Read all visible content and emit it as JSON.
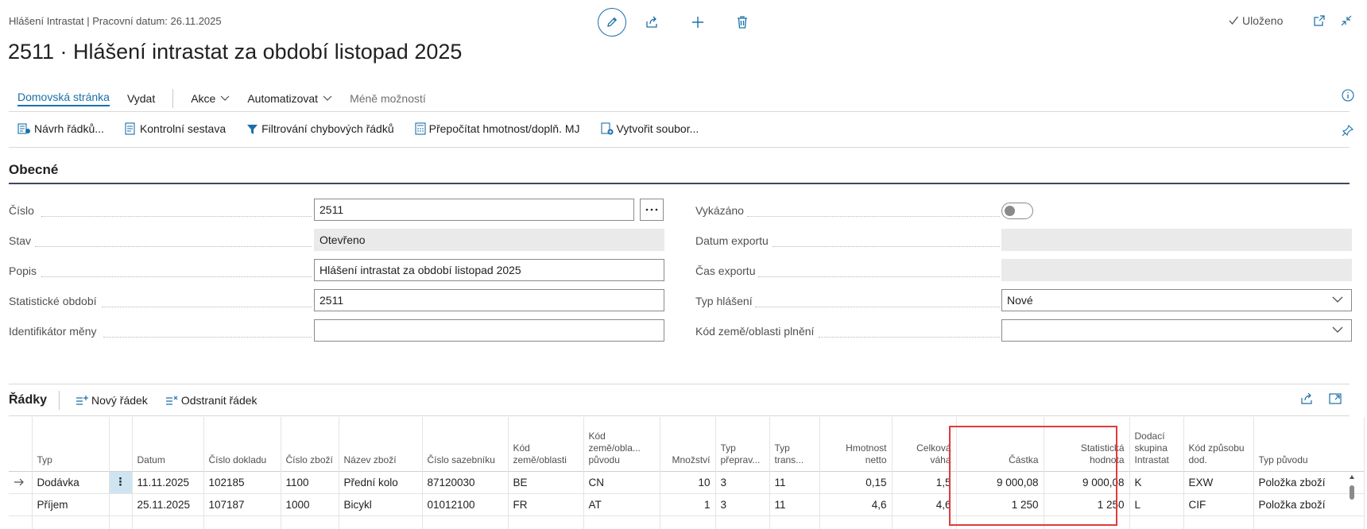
{
  "breadcrumb": "Hlášení Intrastat | Pracovní datum: 26.11.2025",
  "page_title": "2511 · Hlášení intrastat za období listopad 2025",
  "status": {
    "saved_label": "Uloženo"
  },
  "menu": {
    "home": "Domovská stránka",
    "publish": "Vydat",
    "actions": "Akce",
    "automate": "Automatizovat",
    "fewer": "Méně možností"
  },
  "actions": {
    "suggest_lines": "Návrh řádků...",
    "checklist": "Kontrolní sestava",
    "filter_errors": "Filtrování chybových řádků",
    "recalc": "Přepočítat hmotnost/doplň. MJ",
    "create_file": "Vytvořit soubor..."
  },
  "general": {
    "title": "Obecné",
    "fields_left": [
      {
        "label": "Číslo",
        "value": "2511"
      },
      {
        "label": "Stav",
        "value": "Otevřeno"
      },
      {
        "label": "Popis",
        "value": "Hlášení intrastat za období listopad 2025"
      },
      {
        "label": "Statistické období",
        "value": "2511"
      },
      {
        "label": "Identifikátor měny",
        "value": ""
      }
    ],
    "fields_right": [
      {
        "label": "Vykázáno",
        "value": ""
      },
      {
        "label": "Datum exportu",
        "value": ""
      },
      {
        "label": "Čas exportu",
        "value": ""
      },
      {
        "label": "Typ hlášení",
        "value": "Nové"
      },
      {
        "label": "Kód země/oblasti plnění",
        "value": ""
      }
    ],
    "reported_toggle": false
  },
  "lines": {
    "title": "Řádky",
    "new_line": "Nový řádek",
    "delete_line": "Odstranit řádek",
    "columns": [
      "Typ",
      "Datum",
      "Číslo dokladu",
      "Číslo zboží",
      "Název zboží",
      "Číslo sazebníku",
      "Kód země/oblasti",
      "Kód země/obla... původu",
      "Množství",
      "Typ přeprav...",
      "Typ trans...",
      "Hmotnost netto",
      "Celková váha",
      "Částka",
      "Statistická hodnota",
      "Dodací skupina Intrastat",
      "Kód způsobu dod.",
      "Typ původu"
    ],
    "rows": [
      [
        "Dodávka",
        "11.11.2025",
        "102185",
        "1100",
        "Přední kolo",
        "87120030",
        "BE",
        "CN",
        "10",
        "3",
        "11",
        "0,15",
        "1,5",
        "9 000,08",
        "9 000,08",
        "K",
        "EXW",
        "Položka zboží"
      ],
      [
        "Příjem",
        "25.11.2025",
        "107187",
        "1000",
        "Bicykl",
        "01012100",
        "FR",
        "AT",
        "1",
        "3",
        "11",
        "4,6",
        "4,6",
        "1 250",
        "1 250",
        "L",
        "CIF",
        "Položka zboží"
      ]
    ]
  },
  "colors": {
    "accent": "#1a6fa8",
    "highlight": "#e03a3a"
  },
  "icons": [
    "edit-icon",
    "share-icon",
    "plus-icon",
    "trash-icon",
    "check-icon",
    "open-new-icon",
    "collapse-icon",
    "info-icon",
    "pin-icon",
    "expand-icon"
  ]
}
